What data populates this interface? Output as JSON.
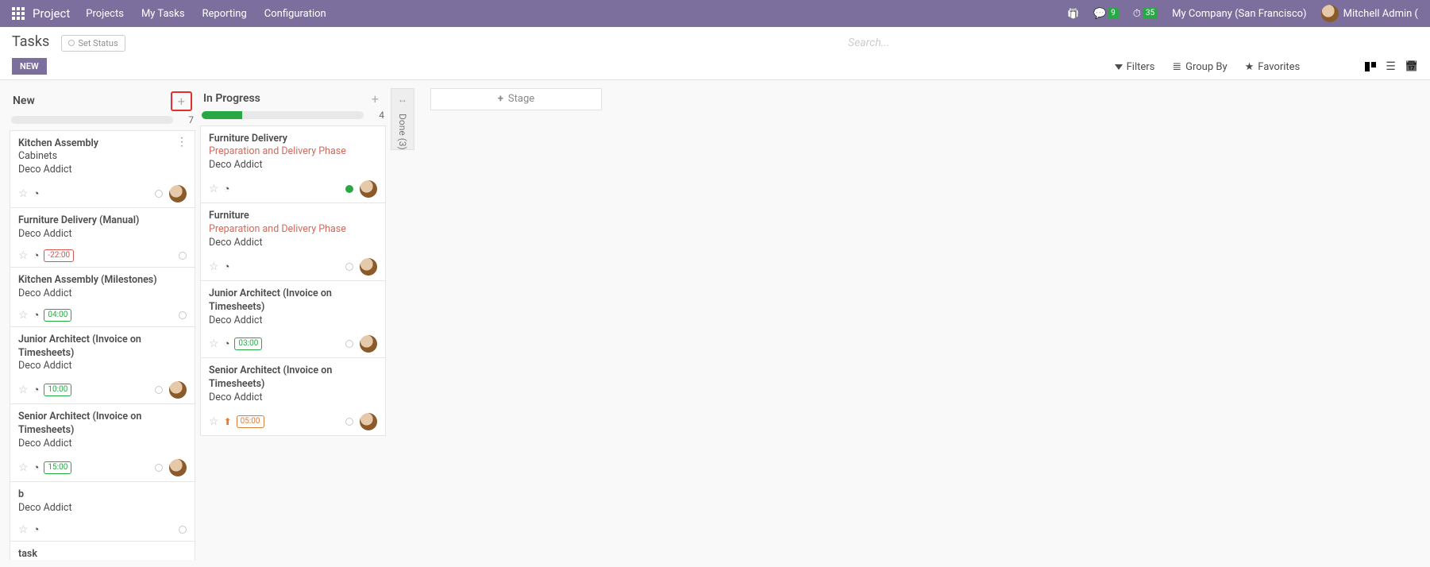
{
  "nav": {
    "brand": "Project",
    "items": [
      "Projects",
      "My Tasks",
      "Reporting",
      "Configuration"
    ],
    "chat_badge": "9",
    "timer_badge": "35",
    "company": "My Company (San Francisco)",
    "user": "Mitchell Admin ("
  },
  "header": {
    "title": "Tasks",
    "set_status": "Set Status",
    "new_btn": "NEW",
    "search_placeholder": "Search..."
  },
  "filters": {
    "filters": "Filters",
    "group_by": "Group By",
    "favorites": "Favorites"
  },
  "add_stage_label": "Stage",
  "collapsed_column": {
    "label": "Done",
    "count": "(3)"
  },
  "columns": [
    {
      "title": "New",
      "count": "7",
      "progress_pct": 0,
      "cards": [
        {
          "title": "Kitchen Assembly",
          "line2": "Cabinets",
          "line3": "Deco Addict",
          "menu": true,
          "time": null,
          "pill": null,
          "status": "open",
          "avatar": true
        },
        {
          "title": "Furniture Delivery (Manual)",
          "line2": "Deco Addict",
          "time": "-22:00",
          "pill": "red",
          "status": "open",
          "avatar": false
        },
        {
          "title": "Kitchen Assembly (Milestones)",
          "line2": "Deco Addict",
          "time": "04:00",
          "pill": "green",
          "status": "open",
          "avatar": false
        },
        {
          "title": "Junior Architect (Invoice on Timesheets)",
          "line2": "Deco Addict",
          "time": "10:00",
          "pill": "green",
          "status": "open",
          "avatar": true
        },
        {
          "title": "Senior Architect (Invoice on Timesheets)",
          "line2": "Deco Addict",
          "time": "15:00",
          "pill": "green",
          "status": "open",
          "avatar": true
        },
        {
          "title": "b",
          "line2": "Deco Addict",
          "time": null,
          "status": "open",
          "avatar": false
        },
        {
          "title": "task"
        }
      ]
    },
    {
      "title": "In Progress",
      "count": "4",
      "progress_pct": 25,
      "cards": [
        {
          "title": "Furniture Delivery",
          "red_line": "Preparation and Delivery Phase",
          "line2": "Deco Addict",
          "time": null,
          "status": "green",
          "avatar": true
        },
        {
          "title": "Furniture",
          "red_line": "Preparation and Delivery Phase",
          "line2": "Deco Addict",
          "time": null,
          "status": "open",
          "avatar": true
        },
        {
          "title": "Junior Architect (Invoice on Timesheets)",
          "line2": "Deco Addict",
          "time": "03:00",
          "pill": "green",
          "status": "open",
          "avatar": true
        },
        {
          "title": "Senior Architect (Invoice on Timesheets)",
          "line2": "Deco Addict",
          "time": "05:00",
          "pill": "orange",
          "upload": true,
          "status": "open",
          "avatar": true
        }
      ]
    }
  ]
}
